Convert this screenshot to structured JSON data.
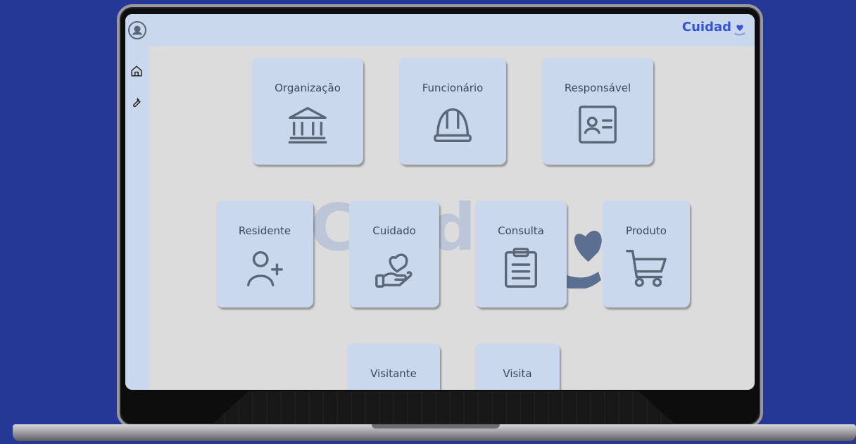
{
  "brand": {
    "name": "Cuidad"
  },
  "watermark": {
    "text": "Cuid"
  },
  "sidebar": {
    "items": [
      {
        "icon": "home-icon"
      },
      {
        "icon": "wrench-icon"
      }
    ]
  },
  "cards": [
    {
      "label": "Organização",
      "icon": "bank-icon"
    },
    {
      "label": "Funcionário",
      "icon": "hard-hat-icon"
    },
    {
      "label": "Responsável",
      "icon": "id-card-icon"
    },
    {
      "label": "Residente",
      "icon": "add-user-icon"
    },
    {
      "label": "Cuidado",
      "icon": "heart-hand-icon"
    },
    {
      "label": "Consulta",
      "icon": "clipboard-icon"
    },
    {
      "label": "Produto",
      "icon": "cart-icon"
    },
    {
      "label": "Visitante",
      "icon": "visitor-icon"
    },
    {
      "label": "Visita",
      "icon": "visit-icon"
    }
  ],
  "colors": {
    "background": "#263896",
    "panel": "#c9d8ec",
    "brand": "#3553d6",
    "icon": "#5b6778"
  }
}
